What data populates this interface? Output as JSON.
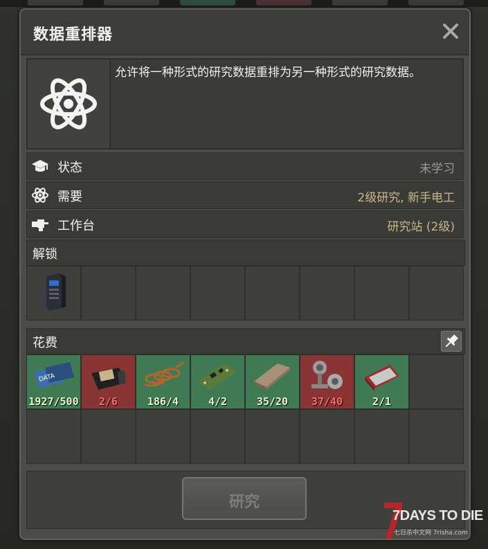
{
  "window": {
    "title": "数据重排器",
    "description": "允许将一种形式的研究数据重排为另一种形式的研究数据。"
  },
  "info_rows": [
    {
      "icon": "graduation-cap-icon",
      "label": "状态",
      "value": "未学习",
      "value_color": "#9b9b96"
    },
    {
      "icon": "atom-icon",
      "label": "需要",
      "value": "2级研究, 新手电工",
      "value_color": "#c7b78a"
    },
    {
      "icon": "workbench-vise-icon",
      "label": "工作台",
      "value": "研究站 (2级)",
      "value_color": "#c7b78a"
    }
  ],
  "unlock": {
    "title": "解锁",
    "items": [
      {
        "icon": "data-rearranger-machine-icon"
      }
    ],
    "slot_count": 8
  },
  "cost": {
    "title": "花费",
    "items": [
      {
        "icon": "research-data-card-icon",
        "have": 1927,
        "need": 500,
        "text": "1927/500",
        "status": "ok"
      },
      {
        "icon": "circuit-board-icon",
        "have": 2,
        "need": 6,
        "text": "2/6",
        "status": "bad"
      },
      {
        "icon": "copper-wire-icon",
        "have": 186,
        "need": 4,
        "text": "186/4",
        "status": "ok"
      },
      {
        "icon": "electronic-parts-icon",
        "have": 4,
        "need": 2,
        "text": "4/2",
        "status": "ok"
      },
      {
        "icon": "metal-ingot-icon",
        "have": 35,
        "need": 20,
        "text": "35/20",
        "status": "ok"
      },
      {
        "icon": "mechanical-parts-icon",
        "have": 37,
        "need": 40,
        "text": "37/40",
        "status": "bad"
      },
      {
        "icon": "display-screen-icon",
        "have": 2,
        "need": 1,
        "text": "2/1",
        "status": "ok"
      }
    ],
    "slot_count": 16
  },
  "actions": {
    "research_label": "研究"
  },
  "watermark": {
    "title": "7DAYS TO DIE",
    "subtitle": "七日杀中文网 7risha.com"
  },
  "colors": {
    "ok_slot": "#3f7a55",
    "bad_slot": "#8a3535",
    "panel": "#4b4c48"
  }
}
